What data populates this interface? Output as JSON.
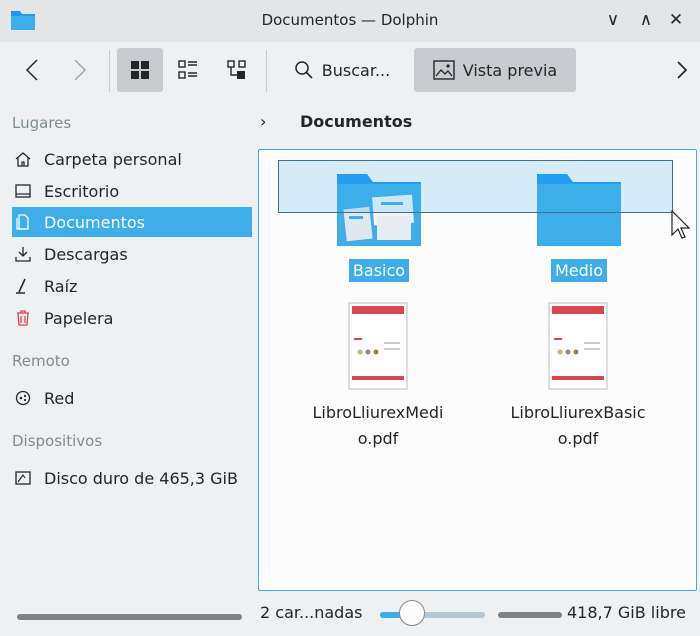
{
  "window": {
    "title": "Documentos — Dolphin"
  },
  "toolbar": {
    "search_label": "Buscar...",
    "preview_label": "Vista previa"
  },
  "sidebar": {
    "places_heading": "Lugares",
    "items": [
      {
        "label": "Carpeta personal",
        "icon": "home-icon"
      },
      {
        "label": "Escritorio",
        "icon": "desktop-icon"
      },
      {
        "label": "Documentos",
        "icon": "documents-icon"
      },
      {
        "label": "Descargas",
        "icon": "download-icon"
      },
      {
        "label": "Raíz",
        "icon": "root-icon"
      },
      {
        "label": "Papelera",
        "icon": "trash-icon"
      }
    ],
    "remote_heading": "Remoto",
    "remote_items": [
      {
        "label": "Red",
        "icon": "network-icon"
      }
    ],
    "devices_heading": "Dispositivos",
    "device_items": [
      {
        "label": "Disco duro de 465,3 GiB",
        "icon": "harddisk-icon"
      }
    ]
  },
  "breadcrumb": {
    "current": "Documentos"
  },
  "files": [
    {
      "name": "Basico",
      "type": "folder",
      "selected": true
    },
    {
      "name": "Medio",
      "type": "folder",
      "selected": true
    },
    {
      "name_line1": "LibroLliurexMedi",
      "name_line2": "o.pdf",
      "type": "pdf",
      "selected": false
    },
    {
      "name_line1": "LibroLliurexBasic",
      "name_line2": "o.pdf",
      "type": "pdf",
      "selected": false
    }
  ],
  "statusbar": {
    "selection_text": "2 car...nadas",
    "free_space": "418,7 GiB libre"
  },
  "colors": {
    "accent": "#3daee9",
    "trash": "#da4453"
  }
}
